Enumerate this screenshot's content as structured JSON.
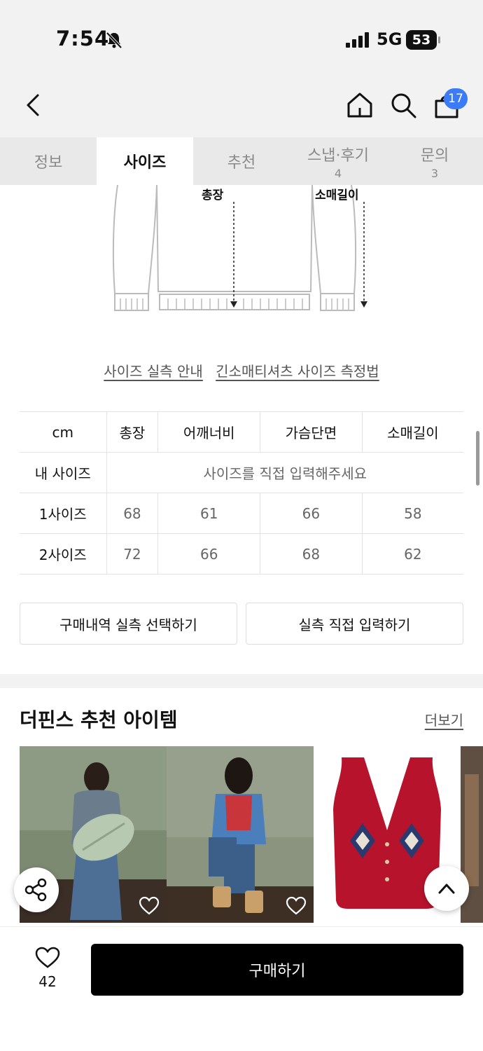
{
  "status_bar": {
    "time": "7:54",
    "network": "5G",
    "battery": "53"
  },
  "header": {
    "cart_count": "17"
  },
  "tabs": [
    {
      "label": "정보",
      "count": ""
    },
    {
      "label": "사이즈",
      "count": ""
    },
    {
      "label": "추천",
      "count": ""
    },
    {
      "label": "스냅·후기",
      "count": "4"
    },
    {
      "label": "문의",
      "count": "3"
    }
  ],
  "diagram": {
    "total_length_label": "총장",
    "sleeve_length_label": "소매길이"
  },
  "guide_links": {
    "size_guide": "사이즈 실측 안내",
    "measure_method": "긴소매티셔츠 사이즈 측정법"
  },
  "size_table": {
    "headers": [
      "cm",
      "총장",
      "어깨너비",
      "가슴단면",
      "소매길이"
    ],
    "my_size_label": "내 사이즈",
    "my_size_placeholder": "사이즈를 직접 입력해주세요",
    "rows": [
      {
        "label": "1사이즈",
        "values": [
          "68",
          "61",
          "66",
          "58"
        ]
      },
      {
        "label": "2사이즈",
        "values": [
          "72",
          "66",
          "68",
          "62"
        ]
      }
    ]
  },
  "buttons": {
    "purchase_history": "구매내역 실측 선택하기",
    "direct_input": "실측 직접 입력하기"
  },
  "recommend": {
    "title": "더핀스 추천 아이템",
    "more": "더보기"
  },
  "bottom_bar": {
    "like_count": "42",
    "buy_label": "구매하기"
  },
  "colors": {
    "accent": "#3b7cf6",
    "buy_button": "#000000"
  }
}
